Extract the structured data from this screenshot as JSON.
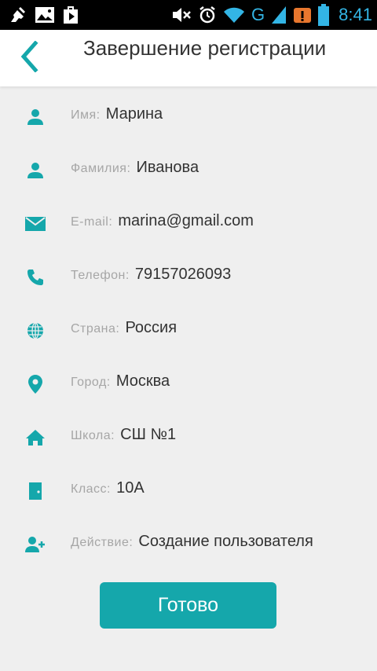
{
  "status_bar": {
    "time": "8:41",
    "network_type": "G",
    "left_icons": [
      "cleaner-icon",
      "gallery-icon",
      "play-store-icon"
    ],
    "right_icons": [
      "mute-icon",
      "alarm-icon",
      "wifi-icon",
      "signal-icon",
      "warning-icon",
      "battery-icon"
    ],
    "accent_color": "#33b5e5"
  },
  "header": {
    "title": "Завершение регистрации",
    "back_icon": "chevron-left-icon"
  },
  "fields": [
    {
      "icon": "person-icon",
      "label": "Имя:",
      "value": "Марина"
    },
    {
      "icon": "person-icon",
      "label": "Фамилия:",
      "value": "Иванова"
    },
    {
      "icon": "mail-icon",
      "label": "E-mail:",
      "value": "marina@gmail.com"
    },
    {
      "icon": "phone-icon",
      "label": "Телефон:",
      "value": "79157026093"
    },
    {
      "icon": "globe-icon",
      "label": "Страна:",
      "value": "Россия"
    },
    {
      "icon": "location-pin-icon",
      "label": "Город:",
      "value": "Москва"
    },
    {
      "icon": "home-icon",
      "label": "Школа:",
      "value": "СШ №1"
    },
    {
      "icon": "door-icon",
      "label": "Класс:",
      "value": "10А"
    },
    {
      "icon": "add-user-icon",
      "label": "Действие:",
      "value": "Создание пользователя"
    }
  ],
  "done_button": {
    "label": "Готово"
  },
  "colors": {
    "accent": "#15a7ab",
    "background": "#efefef",
    "label": "#a6a6a6",
    "value": "#333333"
  }
}
